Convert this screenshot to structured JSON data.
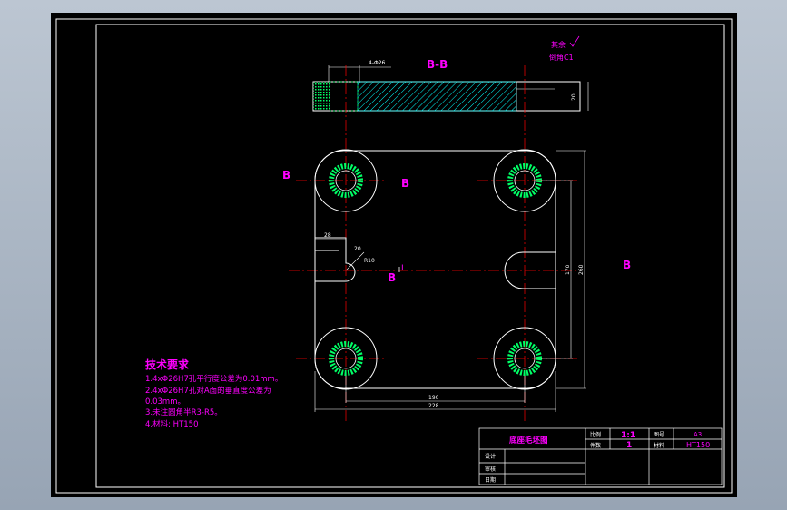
{
  "drawing": {
    "section_title": "B-B",
    "section_marks": [
      "B",
      "B",
      "B",
      "B"
    ],
    "surface_note_1": "其余",
    "surface_note_2": "倒角C1",
    "dims": {
      "holes_top": "4-Φ26",
      "thickness": "20",
      "side_width": "28",
      "slot_r": "R10",
      "slot_w": "20",
      "hole_v_spacing": "170",
      "overall_height": "260",
      "hole_h_spacing": "190",
      "overall_width": "228"
    },
    "ref_letter": "L"
  },
  "tech": {
    "title": "技术要求",
    "lines": [
      "1.4xΦ26H7孔平行度公差为0.01mm。",
      "2.4xΦ26H7孔对A面的垂直度公差为",
      "0.03mm。",
      "3.未注圆角半R3-R5。",
      "4.材料: HT150"
    ]
  },
  "title_block": {
    "part_name": "底座毛坯图",
    "scale_label": "比例",
    "scale_value": "1:1",
    "qty_label": "件数",
    "qty_value": "1",
    "sheet_label": "图号",
    "sheet_value": "A3",
    "material_label": "材料",
    "material_value": "HT150",
    "designer_label": "设计",
    "checker_label": "审核",
    "date_label": "日期"
  },
  "colors": {
    "background": "#000000",
    "frame": "#ffffff",
    "text": "#ff00ff",
    "centerline": "#ff0000",
    "hatch": "#00ffff",
    "hatch_green": "#00ff66"
  }
}
